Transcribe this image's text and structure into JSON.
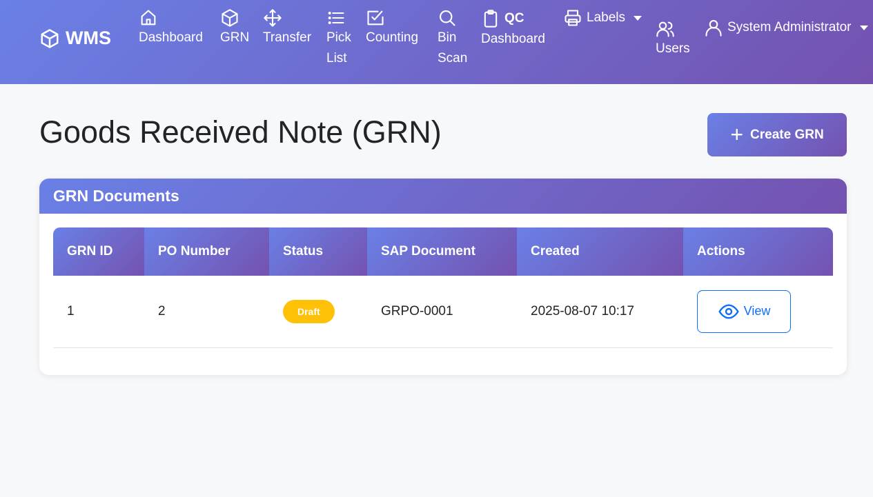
{
  "navbar": {
    "brand": "WMS",
    "items": [
      {
        "label": "Dashboard",
        "icon": "home-icon"
      },
      {
        "label": "GRN",
        "icon": "box-icon"
      },
      {
        "label": "Transfer",
        "icon": "move-arrows-icon"
      },
      {
        "label": "Pick\nList",
        "icon": "list-icon"
      },
      {
        "label": "Counting",
        "icon": "check-square-icon"
      },
      {
        "label": "Bin\nScan",
        "icon": "search-icon"
      },
      {
        "label_top": "QC",
        "label": "Dashboard",
        "icon": "clipboard-icon"
      },
      {
        "label": "Labels",
        "icon": "printer-icon"
      },
      {
        "label": "Users",
        "icon": "users-icon"
      },
      {
        "label": "System Administrator",
        "icon": "user-icon"
      }
    ]
  },
  "page": {
    "title": "Goods Received Note (GRN)",
    "create_label": "Create GRN"
  },
  "card": {
    "title": "GRN Documents",
    "columns": [
      "GRN ID",
      "PO Number",
      "Status",
      "SAP Document",
      "Created",
      "Actions"
    ],
    "rows": [
      {
        "grn_id": "1",
        "po_number": "2",
        "status": "Draft",
        "sap_document": "GRPO-0001",
        "created": "2025-08-07 10:17",
        "action": "View"
      }
    ]
  },
  "colors": {
    "gradient_start": "#6a80e6",
    "gradient_end": "#7452b0",
    "draft_badge": "#ffc107",
    "primary": "#0d6efd"
  }
}
